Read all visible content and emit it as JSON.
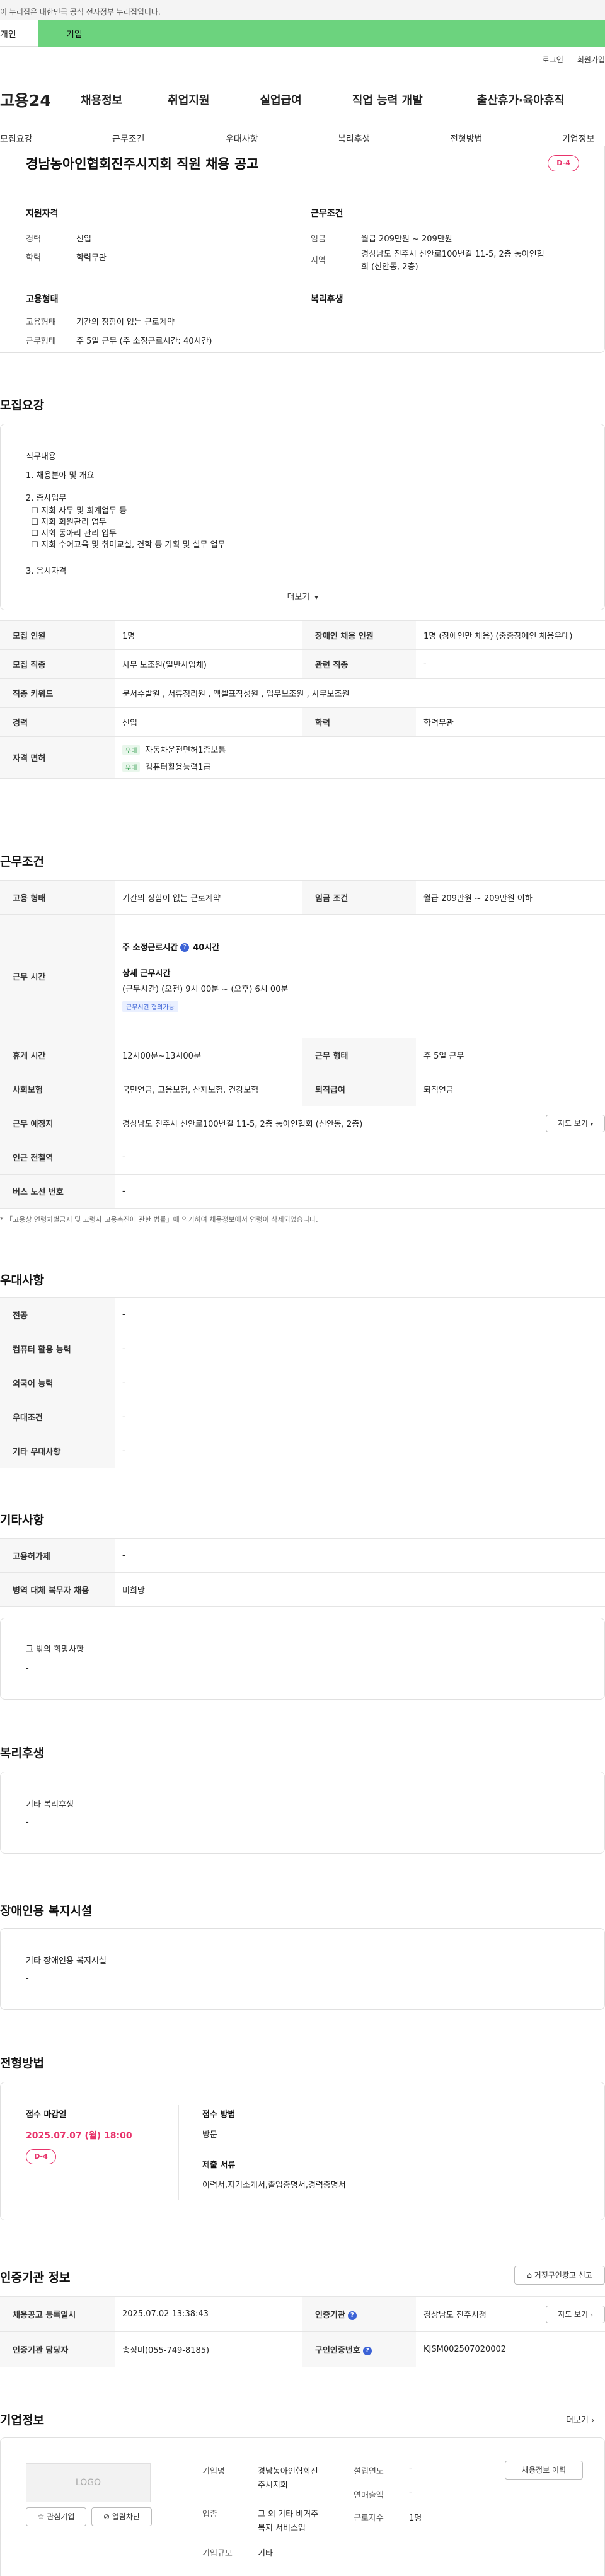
{
  "gov_banner": "이 누리집은 대한민국 공식 전자정부 누리집입니다.",
  "tabs": {
    "person": "개인",
    "biz": "기업"
  },
  "util": {
    "login": "로그인",
    "join": "회원가입"
  },
  "logo": "고용24",
  "gnb": [
    "채용정보",
    "취업지원",
    "실업급여",
    "직업 능력 개발",
    "출산휴가·육아휴직"
  ],
  "anchors": [
    "모집요강",
    "근무조건",
    "우대사항",
    "복리후생",
    "전형방법",
    "기업정보"
  ],
  "job": {
    "title": "경남농아인협회진주시지회 직원 채용 공고",
    "dday": "D-4",
    "qual_head": "지원자격",
    "career_lbl": "경력",
    "career_val": "신입",
    "edu_lbl": "학력",
    "edu_val": "학력무관",
    "cond_head": "근무조건",
    "wage_lbl": "임금",
    "wage_val": "월급 209만원 ~ 209만원",
    "loc_lbl": "지역",
    "loc_val1": "경상남도 진주시 신안로100번길 11-5, 2층 농아인협",
    "loc_val2": "회 (신안동, 2층)",
    "emp_head": "고용형태",
    "emp_lbl": "고용형태",
    "emp_val": "기간의 정함이 없는 근로계약",
    "work_lbl": "근무형태",
    "work_val": "주 5일 근무 (주 소정근로시간: 40시간)",
    "welfare_head": "복리후생"
  },
  "recruit": {
    "heading": "모집요강",
    "desc_title": "직무내용",
    "lines": [
      "1. 채용분야 및 개요",
      "2. 종사업무",
      "  ☐ 지회 사무 및 회계업무 등",
      "  ☐ 지회 회원관리 업무",
      "  ☐ 지회 동아리 관리 업무",
      "  ☐ 지회 수어교육 및 취미교실, 견학 등 기획 및 실무 업무",
      "3. 응시자격"
    ],
    "more": "더보기",
    "rows": {
      "count_lbl": "모집 인원",
      "count_val": "1명",
      "dis_lbl": "장애인 채용 인원",
      "dis_val": "1명 (장애인만 채용) (중증장애인 채용우대)",
      "job_lbl": "모집 직종",
      "job_val": "사무 보조원(일반사업체)",
      "rel_lbl": "관련 직종",
      "rel_val": "-",
      "kw_lbl": "직종 키워드",
      "kw_val": "문서수발원 , 서류정리원 , 엑셀표작성원 , 업무보조원 , 사무보조원",
      "car_lbl": "경력",
      "car_val": "신입",
      "edu_lbl": "학력",
      "edu_val": "학력무관",
      "lic_lbl": "자격 면허",
      "lic1_tag": "우대",
      "lic1": "자동차운전면허1종보통",
      "lic2_tag": "우대",
      "lic2": "컴퓨터활용능력1급"
    }
  },
  "work": {
    "heading": "근무조건",
    "type_lbl": "고용 형태",
    "type_val": "기간의 정함이 없는 근로계약",
    "wage_lbl": "임금 조건",
    "wage_val": "월급 209만원 ~ 209만원 이하",
    "time_lbl": "근무 시간",
    "week_hours_lbl": "주 소정근로시간",
    "week_hours_val": "40시간",
    "detail_lbl": "상세 근무시간",
    "detail_val": "(근무시간) (오전) 9시 00분 ~ (오후) 6시 00분",
    "nego_chip": "근무시간 협의가능",
    "rest_lbl": "휴게 시간",
    "rest_val": "12시00분~13시00분",
    "form_lbl": "근무 형태",
    "form_val": "주 5일 근무",
    "ins_lbl": "사회보험",
    "ins_val": "국민연금, 고용보험, 산재보험, 건강보험",
    "ret_lbl": "퇴직급여",
    "ret_val": "퇴직연금",
    "place_lbl": "근무 예정지",
    "place_val": "경상남도 진주시 신안로100번길 11-5, 2층 농아인협회 (신안동, 2층)",
    "map_btn": "지도 보기",
    "sub_lbl": "인근 전철역",
    "sub_val": "-",
    "bus_lbl": "버스 노선 번호",
    "bus_val": "-",
    "notice": "* 「고용상 연령차별금지 및 고령자 고용촉진에 관한 법률」에 의거하여 채용정보에서 연령이 삭제되었습니다."
  },
  "pref": {
    "heading": "우대사항",
    "major_lbl": "전공",
    "major_val": "-",
    "comp_lbl": "컴퓨터 활용 능력",
    "comp_val": "-",
    "lang_lbl": "외국어 능력",
    "lang_val": "-",
    "cond_lbl": "우대조건",
    "cond_val": "-",
    "etc_lbl": "기타 우대사항",
    "etc_val": "-"
  },
  "etc": {
    "heading": "기타사항",
    "hire_lbl": "고용허가제",
    "hire_val": "-",
    "mil_lbl": "병역 대체 복무자 채용",
    "mil_val": "비희망",
    "other_title": "그 밖의 희망사항",
    "other_val": "-"
  },
  "welfare": {
    "heading": "복리후생",
    "title": "기타 복리후생",
    "val": "-"
  },
  "disabled": {
    "heading": "장애인용 복지시설",
    "title": "기타 장애인용 복지시설",
    "val": "-"
  },
  "screen": {
    "heading": "전형방법",
    "deadline_lbl": "접수 마감일",
    "deadline_val": "2025.07.07 (월) 18:00",
    "dday": "D-4",
    "method_lbl": "접수 방법",
    "method_val": "방문",
    "docs_lbl": "제출 서류",
    "docs_val": "이력서,자기소개서,졸업증명서,경력증명서"
  },
  "cert": {
    "heading": "인증기관 정보",
    "report_btn": "거짓구인광고 신고",
    "reg_lbl": "채용공고 등록일시",
    "reg_val": "2025.07.02 13:38:43",
    "org_lbl": "인증기관",
    "org_val": "경상남도 진주시청",
    "map_btn": "지도 보기",
    "mgr_lbl": "인증기관 담당자",
    "mgr_val": "송정미(055-749-8185)",
    "no_lbl": "구인인증번호",
    "no_val": "KJSM002507020002"
  },
  "company": {
    "heading": "기업정보",
    "more": "더보기",
    "logo_placeholder": "LOGO",
    "fav_btn": "관심기업",
    "block_btn": "열람차단",
    "name_lbl": "기업명",
    "name_val1": "경남농아인협회진",
    "name_val2": "주시지회",
    "est_lbl": "설립연도",
    "est_val": "-",
    "ind_lbl": "업종",
    "ind_val1": "그 외 기타 비거주",
    "ind_val2": "복지 서비스업",
    "sales_lbl": "연매출액",
    "sales_val": "-",
    "emp_lbl": "근로자수",
    "emp_val": "1명",
    "size_lbl": "기업규모",
    "size_val": "기타",
    "jobs_btn": "채용정보 이력"
  },
  "colors": {
    "accent_green": "#6cd37e",
    "dday_red": "#e8336b",
    "info_blue": "#3b62d6"
  }
}
